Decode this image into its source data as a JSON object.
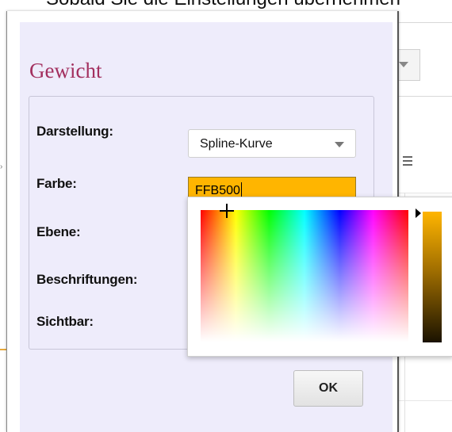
{
  "background": {
    "caption": "Sobald Sie die Einstellungen übernehmen"
  },
  "dialog": {
    "title": "Gewicht",
    "fields": {
      "darstellung_label": "Darstellung:",
      "farbe_label": "Farbe:",
      "ebene_label": "Ebene:",
      "beschriftungen_label": "Beschriftungen:",
      "sichtbar_label": "Sichtbar:"
    },
    "darstellung_value": "Spline-Kurve",
    "farbe_value": "FFB500",
    "ok_label": "OK"
  },
  "colors": {
    "selected": "#FFB500",
    "title": "#A3305F",
    "dialog_bg": "#EEECFB"
  },
  "icons": {
    "dropdown": "chevron-down-icon",
    "menu": "hamburger-icon"
  }
}
